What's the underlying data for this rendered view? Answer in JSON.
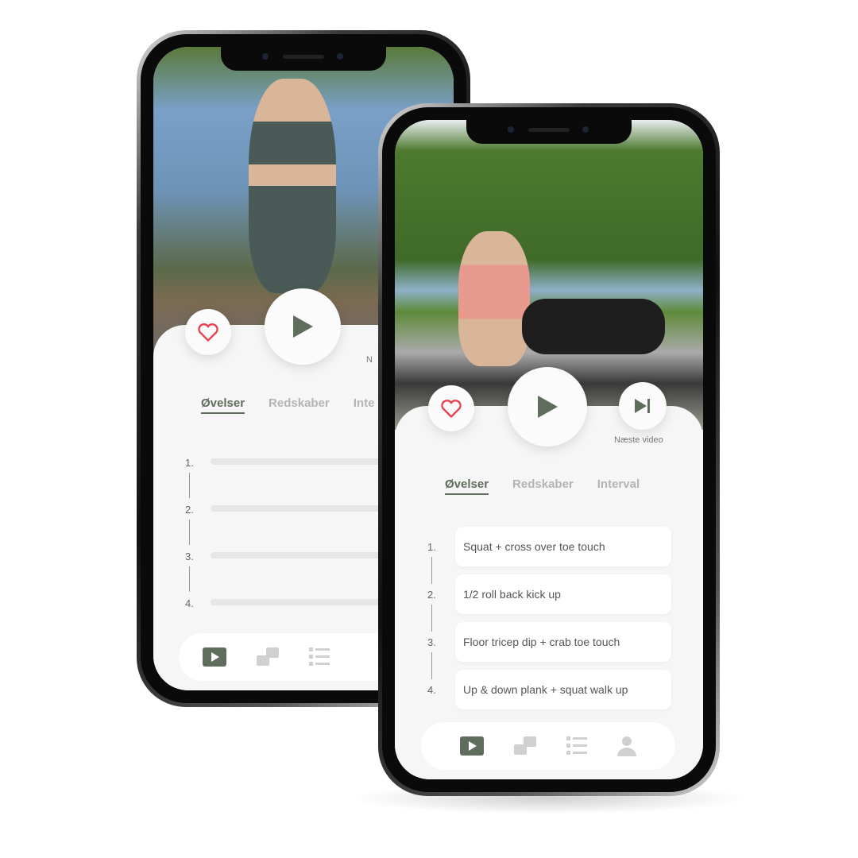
{
  "colors": {
    "accent": "#5f6d5c",
    "heart": "#e8414f",
    "inactive": "#d0d0d0"
  },
  "back_phone": {
    "tabs": [
      {
        "label": "Øvelser",
        "active": true
      },
      {
        "label": "Redskaber"
      },
      {
        "label": "Inte"
      }
    ],
    "next_label_partial": "N",
    "numbers": [
      "1.",
      "2.",
      "3.",
      "4."
    ]
  },
  "front_phone": {
    "next_video_label": "Næste video",
    "tabs": [
      {
        "label": "Øvelser",
        "active": true
      },
      {
        "label": "Redskaber"
      },
      {
        "label": "Interval"
      }
    ],
    "exercises": [
      {
        "number": "1.",
        "name": "Squat + cross over toe touch"
      },
      {
        "number": "2.",
        "name": "1/2 roll back kick up"
      },
      {
        "number": "3.",
        "name": "Floor tricep dip + crab toe touch"
      },
      {
        "number": "4.",
        "name": "Up & down plank  + squat walk up"
      }
    ],
    "nav": [
      {
        "icon": "play-icon",
        "active": true
      },
      {
        "icon": "videos-icon"
      },
      {
        "icon": "list-icon"
      },
      {
        "icon": "profile-icon"
      }
    ]
  }
}
